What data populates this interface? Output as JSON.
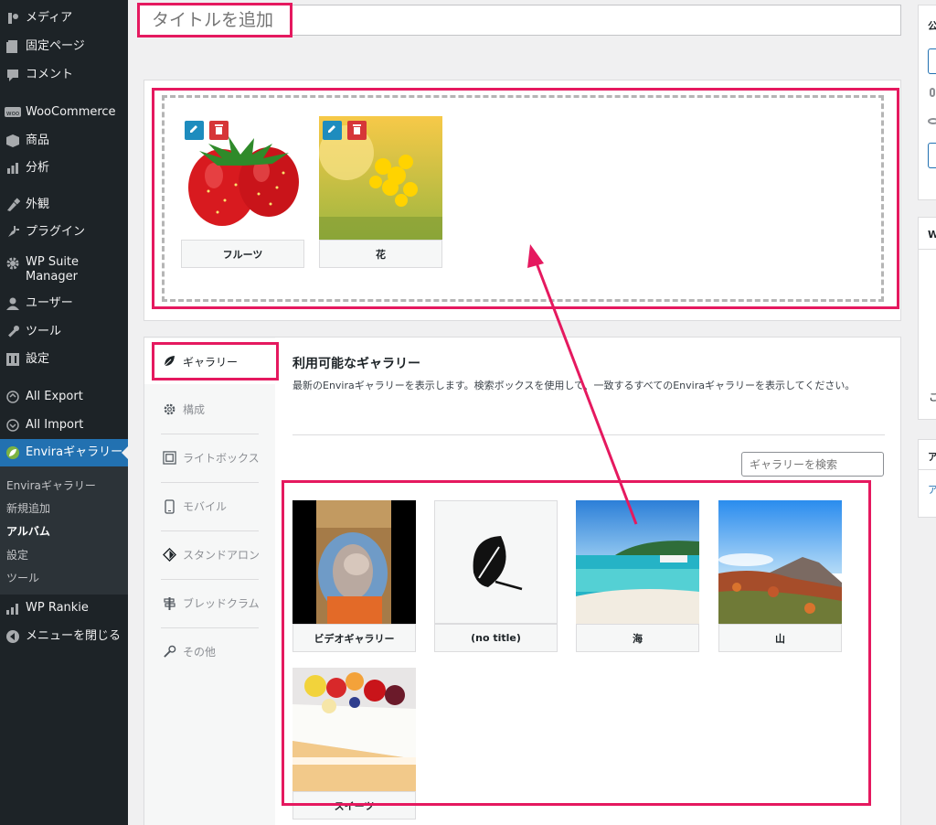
{
  "sidebar": {
    "items": [
      {
        "label": "メディア",
        "icon": "media-icon"
      },
      {
        "label": "固定ページ",
        "icon": "page-icon"
      },
      {
        "label": "コメント",
        "icon": "comment-icon"
      },
      {
        "label": "WooCommerce",
        "icon": "woo-icon"
      },
      {
        "label": "商品",
        "icon": "product-icon"
      },
      {
        "label": "分析",
        "icon": "analytics-icon"
      },
      {
        "label": "外観",
        "icon": "appearance-icon"
      },
      {
        "label": "プラグイン",
        "icon": "plugin-icon"
      },
      {
        "label": "WP Suite Manager",
        "icon": "gear-icon"
      },
      {
        "label": "ユーザー",
        "icon": "user-icon"
      },
      {
        "label": "ツール",
        "icon": "wrench-icon"
      },
      {
        "label": "設定",
        "icon": "settings-icon"
      },
      {
        "label": "All Export",
        "icon": "export-icon"
      },
      {
        "label": "All Import",
        "icon": "import-icon"
      },
      {
        "label": "Enviraギャラリー",
        "icon": "envira-leaf-icon"
      },
      {
        "label": "WP Rankie",
        "icon": "rankie-icon"
      },
      {
        "label": "メニューを閉じる",
        "icon": "collapse-icon"
      }
    ],
    "submenu": [
      "Enviraギャラリー",
      "新規追加",
      "アルバム",
      "設定",
      "ツール"
    ],
    "active_color": "#2271b1"
  },
  "title": {
    "placeholder": "タイトルを追加"
  },
  "album": {
    "items": [
      {
        "caption": "フルーツ"
      },
      {
        "caption": "花"
      }
    ]
  },
  "tabs": [
    {
      "label": "ギャラリー",
      "icon": "leaf-icon"
    },
    {
      "label": "構成",
      "icon": "gear-icon"
    },
    {
      "label": "ライトボックス",
      "icon": "lightbox-icon"
    },
    {
      "label": "モバイル",
      "icon": "mobile-icon"
    },
    {
      "label": "スタンドアロン",
      "icon": "standalone-icon"
    },
    {
      "label": "ブレッドクラム",
      "icon": "signpost-icon"
    },
    {
      "label": "その他",
      "icon": "wrench-icon"
    }
  ],
  "galleries": {
    "heading": "利用可能なギャラリー",
    "description": "最新のEnviraギャラリーを表示します。検索ボックスを使用して、一致するすべてのEnviraギャラリーを表示してください。",
    "search_placeholder": "ギャラリーを検索",
    "items": [
      {
        "caption": "ビデオギャラリー"
      },
      {
        "caption": "(no title)"
      },
      {
        "caption": "海"
      },
      {
        "caption": "山"
      },
      {
        "caption": "スイーツ"
      }
    ]
  },
  "right_side": {
    "box1_title": "公",
    "box2_title": "W",
    "box2_text": "こ",
    "box3_title": "ア",
    "box3_link": "ア"
  },
  "annotation_color": "#e5195f"
}
